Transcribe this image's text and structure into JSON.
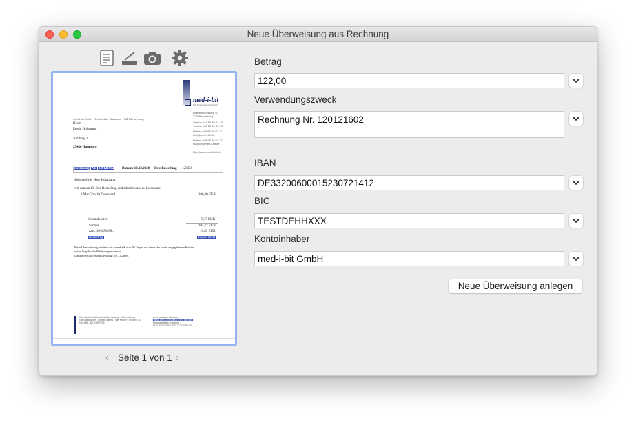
{
  "window": {
    "title": "Neue Überweisung aus Rechnung"
  },
  "toolbar": {
    "icons": [
      "document-icon",
      "scanner-icon",
      "camera-icon",
      "gear-icon"
    ]
  },
  "preview": {
    "document": {
      "logo_name": "med-i-bit",
      "logo_sub": "EDV-Beratungsgesellschaft mbH",
      "sender_line": "med-i-bit GmbH · Bramfelder Chaussee · 22159 Hamburg",
      "sender_address": [
        "Brauerknechtweg 40",
        "22095 Hamburg"
      ],
      "contact_lines": [
        "Telefon   040 55 40 57 10",
        "Telefax   040 55 40 57 13",
        "",
        "Hotline   040 55 40 57 11",
        "info@med-i-bit.de",
        "",
        "Hotline   040 55 40 57 12",
        "support@med-i-bit.de",
        "",
        "http://www.med-i-bit.de"
      ],
      "recipient": [
        "Herrn",
        "Erwin Holzmann",
        "",
        "Am Weg 3",
        "",
        "23456 Hamburg"
      ],
      "ref_rechnung": "Rechnung",
      "ref_nr": "Nr.",
      "ref_nr_value": "120121602",
      "ref_datum": "Datum: 10.12.2020",
      "ref_bestellung": "Ihre Bestellung",
      "ref_bestellung_value": "123456",
      "greeting": "Sehr geehrter Herr Holzmann,",
      "intro": "wir danken für Ihre Bestellung und erlauben uns zu berechnen:",
      "item": "1 MacGiro 10 Download",
      "item_price": "100,00 EUR",
      "shipping": "Versandkosten",
      "shipping_price": "5,17 EUR",
      "sum": "Summe",
      "sum_price": "105,17 EUR",
      "vat": "zzgl. 16% MWSt.",
      "vat_price": "16,83 EUR",
      "total": "Endbetrag",
      "total_price": "122,00 EUR",
      "payment": "Bitte Überweisung erbitten wir innerhalb von 10 Tagen auf einen der unten angegebenen Konten",
      "payment2": "unter Angabe der Rechnungsnummer.",
      "delivery": "Datum der Lieferung/Leistung: 10.12.2020.",
      "footer_left": [
        "Gesellschaft mit beschränkter Haftung · Sitz Hamburg",
        "Geschäftsführer: Thomas Harms · Nils Kröger · HRB 90 721",
        "USt-IdNr.: DE 118970713"
      ],
      "footer_right": [
        "Commerzbank Hamburg",
        "IBAN DE33 2004 0000 0123 4567 89",
        "Deutsche Bank Hamburg",
        "IBAN DE07 2007 0024 0123 7990 00"
      ]
    }
  },
  "pager": {
    "label": "Seite 1 von 1",
    "prev": "‹",
    "next": "›"
  },
  "form": {
    "betrag": {
      "label": "Betrag",
      "value": "122,00"
    },
    "verwendungszweck": {
      "label": "Verwendungszweck",
      "value": "Rechnung Nr. 120121602"
    },
    "iban": {
      "label": "IBAN",
      "value": "DE33200600015230721412"
    },
    "bic": {
      "label": "BIC",
      "value": "TESTDEHHXXX"
    },
    "kontoinhaber": {
      "label": "Kontoinhaber",
      "value": "med-i-bit GmbH"
    },
    "submit": "Neue Überweisung anlegen"
  }
}
